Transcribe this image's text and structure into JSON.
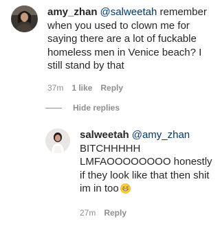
{
  "comment": {
    "avatar_icon": "user-avatar-icon",
    "username": "amy_zhan",
    "mention": "@salweetah",
    "text": " remember when you used to clown me for saying there are a lot of fuckable homeless men in Venice beach? I still stand by that",
    "time": "37m",
    "likes": "1 like",
    "reply_label": "Reply"
  },
  "hide_replies_label": "Hide replies",
  "reply": {
    "avatar_icon": "user-avatar-icon",
    "username": "salweetah",
    "mention": "@amy_zhan",
    "text": "BITCHHHHH LMFAOOOOOOOO honestly if they look like that then shit im in too",
    "emoji_icon": "grinning-sweat-emoji-icon",
    "time": "27m",
    "reply_label": "Reply"
  },
  "colors": {
    "text": "#262626",
    "meta": "#8e8e8e",
    "mention": "#00376b"
  }
}
